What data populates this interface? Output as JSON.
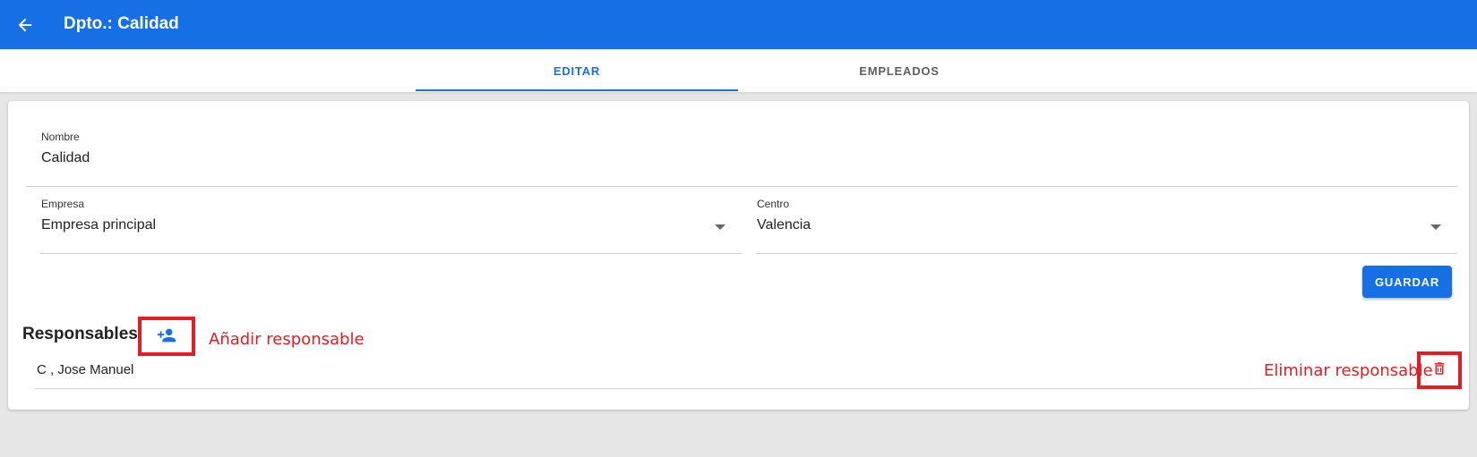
{
  "appbar": {
    "back_icon": "arrow-left-icon",
    "title": "Dpto.: Calidad",
    "color": "#176fe6"
  },
  "tabs": [
    {
      "label": "EDITAR",
      "active": true
    },
    {
      "label": "EMPLEADOS",
      "active": false
    }
  ],
  "form": {
    "nombre": {
      "label": "Nombre",
      "value": "Calidad"
    },
    "empresa": {
      "label": "Empresa",
      "value": "Empresa principal"
    },
    "centro": {
      "label": "Centro",
      "value": "Valencia"
    },
    "save_label": "GUARDAR"
  },
  "responsables": {
    "title": "Responsables",
    "add_icon": "person-add-icon",
    "items": [
      {
        "name": "C , Jose Manuel",
        "delete_icon": "trash-icon"
      }
    ]
  },
  "annotations": {
    "add": "Añadir responsable",
    "delete": "Eliminar responsable",
    "color": "#e51c23"
  }
}
